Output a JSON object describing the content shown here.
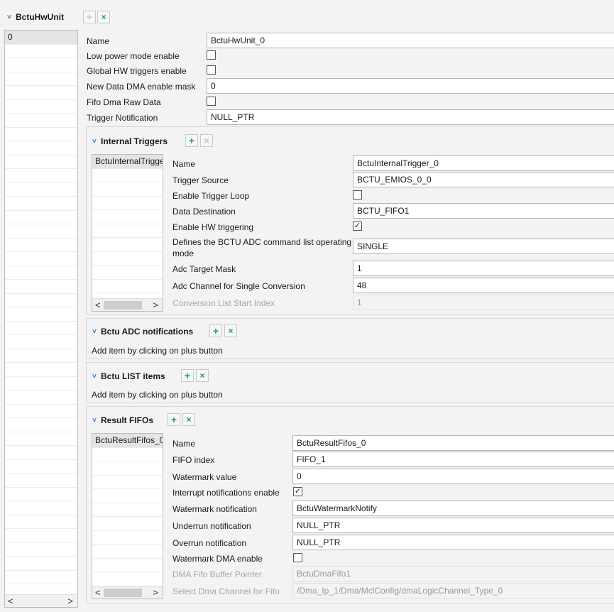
{
  "hw_unit": {
    "title": "BctuHwUnit",
    "list_items": [
      "0"
    ],
    "fields": {
      "name_label": "Name",
      "name_value": "BctuHwUnit_0",
      "low_power_label": "Low power mode enable",
      "low_power_checked": false,
      "global_hw_label": "Global HW triggers enable",
      "global_hw_checked": false,
      "dma_mask_label": "New Data DMA enable mask",
      "dma_mask_value": "0",
      "fifo_raw_label": "Fifo Dma Raw Data",
      "fifo_raw_checked": false,
      "trigger_notif_label": "Trigger Notification",
      "trigger_notif_value": "NULL_PTR"
    }
  },
  "internal_triggers": {
    "title": "Internal Triggers",
    "list_items": [
      "BctuInternalTrigge"
    ],
    "name_label": "Name",
    "name_value": "BctuInternalTrigger_0",
    "source_label": "Trigger Source",
    "source_value": "BCTU_EMIOS_0_0",
    "loop_label": "Enable Trigger Loop",
    "loop_checked": false,
    "dest_label": "Data Destination",
    "dest_value": "BCTU_FIFO1",
    "hwtrig_label": "Enable HW triggering",
    "hwtrig_checked": true,
    "mode_label_1": "Defines the BCTU ADC command list operating",
    "mode_label_2": "mode",
    "mode_value": "SINGLE",
    "target_label": "Adc Target Mask",
    "target_value": "1",
    "channel_label": "Adc Channel for Single Conversion",
    "channel_value": "48",
    "start_label": "Conversion List Start Index",
    "start_value": "1"
  },
  "adc_notifications": {
    "title": "Bctu ADC notifications",
    "hint": "Add item by clicking on plus button"
  },
  "list_items_section": {
    "title": "Bctu LIST items",
    "hint": "Add item by clicking on plus button"
  },
  "result_fifos": {
    "title": "Result FIFOs",
    "list_items": [
      "BctuResultFifos_0"
    ],
    "name_label": "Name",
    "name_value": "BctuResultFifos_0",
    "index_label": "FIFO index",
    "index_value": "FIFO_1",
    "wm_label": "Watermark value",
    "wm_value": "0",
    "irq_label": "Interrupt notifications enable",
    "irq_checked": true,
    "wm_notif_label": "Watermark notification",
    "wm_notif_value": "BctuWatermarkNotify",
    "under_label": "Underrun notification",
    "under_value": "NULL_PTR",
    "over_label": "Overrun notification",
    "over_value": "NULL_PTR",
    "wm_dma_label": "Watermark DMA enable",
    "wm_dma_checked": false,
    "dma_buf_label": "DMA Fifo Buffer Pointer",
    "dma_buf_value": "BctuDmaFifo1",
    "dma_ch_label": "Select Dma Channel for Fifo",
    "dma_ch_value": "/Dma_Ip_1/Dma/MclConfig/dmaLogicChannel_Type_0"
  },
  "icons": {
    "add": "+",
    "remove": "×",
    "check": "✓",
    "chevron": "˅",
    "left": "<",
    "right": ">"
  }
}
